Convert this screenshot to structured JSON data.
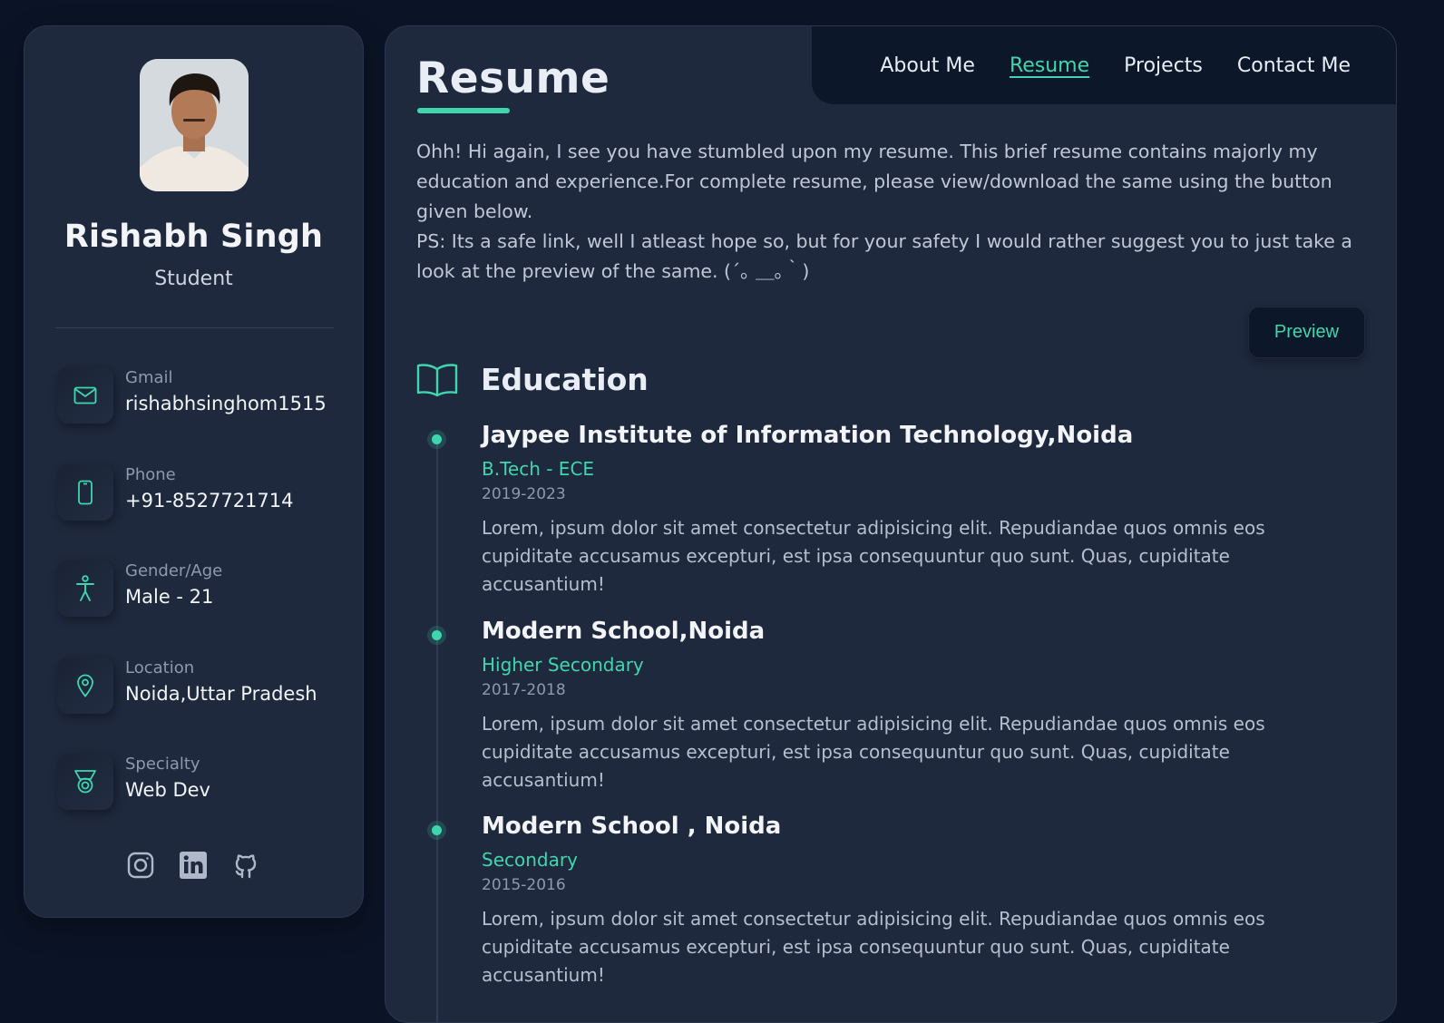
{
  "profile": {
    "name": "Rishabh Singh",
    "role": "Student"
  },
  "contacts": [
    {
      "label": "Gmail",
      "value": "rishabhsinghom1515",
      "icon": "mail-icon"
    },
    {
      "label": "Phone",
      "value": "+91-8527721714",
      "icon": "phone-icon"
    },
    {
      "label": "Gender/Age",
      "value": "Male - 21",
      "icon": "person-icon"
    },
    {
      "label": "Location",
      "value": "Noida,Uttar Pradesh",
      "icon": "location-pin-icon"
    },
    {
      "label": "Specialty",
      "value": "Web Dev",
      "icon": "medal-icon"
    }
  ],
  "socials": [
    "instagram-icon",
    "linkedin-icon",
    "github-icon"
  ],
  "nav": {
    "about": "About Me",
    "resume": "Resume",
    "projects": "Projects",
    "contact": "Contact Me",
    "active": "resume"
  },
  "page": {
    "title": "Resume",
    "intro_line1": "Ohh! Hi again, I see you have stumbled upon my resume. This brief resume contains majorly my education and experience.For complete resume, please view/download the same using the button given below.",
    "intro_line2": "PS: Its a safe link, well I atleast hope so, but for your safety I would rather suggest you to just take a look at the preview of the same. (´｡ ＿｡｀)",
    "preview_label": "Preview"
  },
  "education": {
    "title": "Education",
    "items": [
      {
        "school": "Jaypee Institute of Information Technology,Noida",
        "degree": "B.Tech - ECE",
        "years": "2019-2023",
        "description": "Lorem, ipsum dolor sit amet consectetur adipisicing elit. Repudiandae quos omnis eos cupiditate accusamus excepturi, est ipsa consequuntur quo sunt. Quas, cupiditate accusantium!"
      },
      {
        "school": "Modern School,Noida",
        "degree": "Higher Secondary",
        "years": "2017-2018",
        "description": "Lorem, ipsum dolor sit amet consectetur adipisicing elit. Repudiandae quos omnis eos cupiditate accusamus excepturi, est ipsa consequuntur quo sunt. Quas, cupiditate accusantium!"
      },
      {
        "school": "Modern School , Noida",
        "degree": "Secondary",
        "years": "2015-2016",
        "description": "Lorem, ipsum dolor sit amet consectetur adipisicing elit. Repudiandae quos omnis eos cupiditate accusamus excepturi, est ipsa consequuntur quo sunt. Quas, cupiditate accusantium!"
      }
    ]
  },
  "colors": {
    "background": "#0b1426",
    "panel": "#1e293d",
    "accent": "#3fd6ae",
    "navbar": "#0c1729"
  }
}
